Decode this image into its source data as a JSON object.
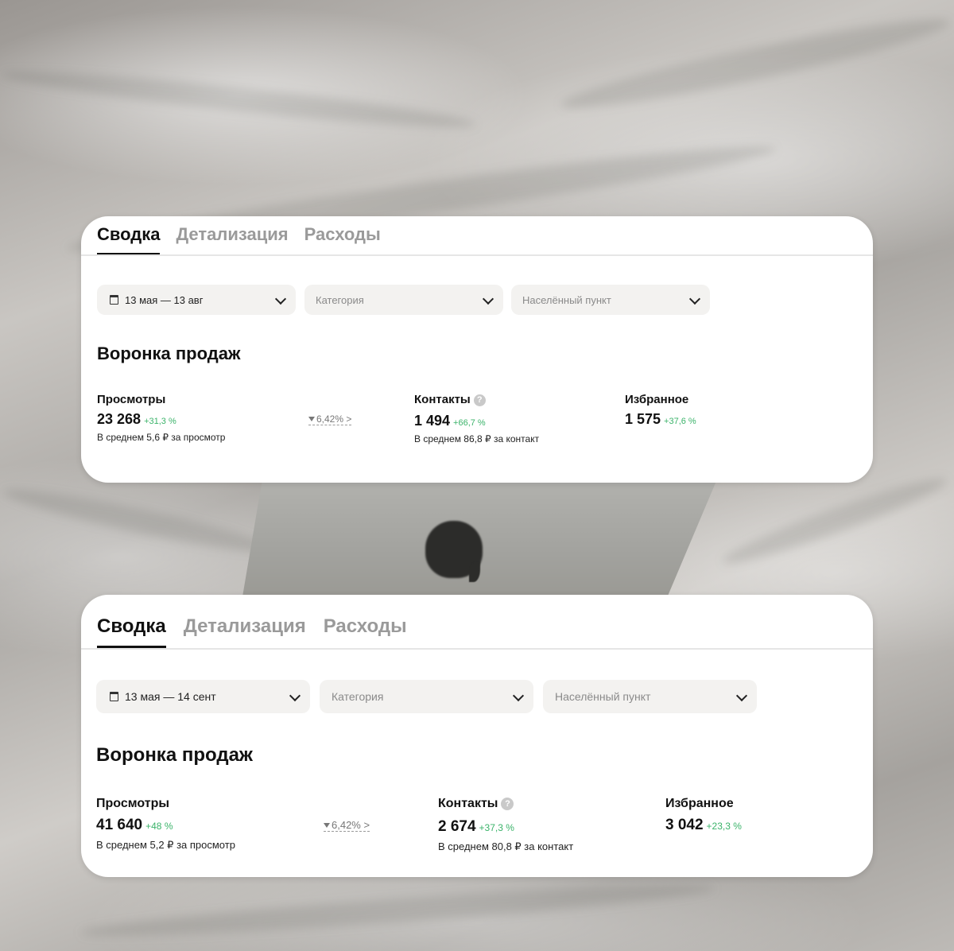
{
  "panels": [
    {
      "tabs": [
        {
          "label": "Сводка",
          "active": true
        },
        {
          "label": "Детализация",
          "active": false
        },
        {
          "label": "Расходы",
          "active": false
        }
      ],
      "filters": {
        "date": "13 мая — 13 авг",
        "category_placeholder": "Категория",
        "city_placeholder": "Населённый пункт"
      },
      "section_title": "Воронка продаж",
      "metrics": {
        "views": {
          "label": "Просмотры",
          "value": "23 268",
          "delta": "+31,3 %",
          "sub": "В среднем 5,6 ₽ за просмотр"
        },
        "conversion": "6,42% >",
        "contacts": {
          "label": "Контакты",
          "help": "?",
          "value": "1 494",
          "delta": "+66,7 %",
          "sub": "В среднем 86,8 ₽ за контакт"
        },
        "favorites": {
          "label": "Избранное",
          "value": "1 575",
          "delta": "+37,6 %"
        }
      }
    },
    {
      "tabs": [
        {
          "label": "Сводка",
          "active": true
        },
        {
          "label": "Детализация",
          "active": false
        },
        {
          "label": "Расходы",
          "active": false
        }
      ],
      "filters": {
        "date": "13 мая — 14 сент",
        "category_placeholder": "Категория",
        "city_placeholder": "Населённый пункт"
      },
      "section_title": "Воронка продаж",
      "metrics": {
        "views": {
          "label": "Просмотры",
          "value": "41 640",
          "delta": "+48 %",
          "sub": "В среднем 5,2 ₽ за просмотр"
        },
        "conversion": "6,42% >",
        "contacts": {
          "label": "Контакты",
          "help": "?",
          "value": "2 674",
          "delta": "+37,3 %",
          "sub": "В среднем 80,8 ₽ за контакт"
        },
        "favorites": {
          "label": "Избранное",
          "value": "3 042",
          "delta": "+23,3 %"
        }
      }
    }
  ],
  "colors": {
    "positive_delta": "#3bb36a",
    "active_tab": "#111111",
    "inactive_tab": "#9a9a9a"
  }
}
